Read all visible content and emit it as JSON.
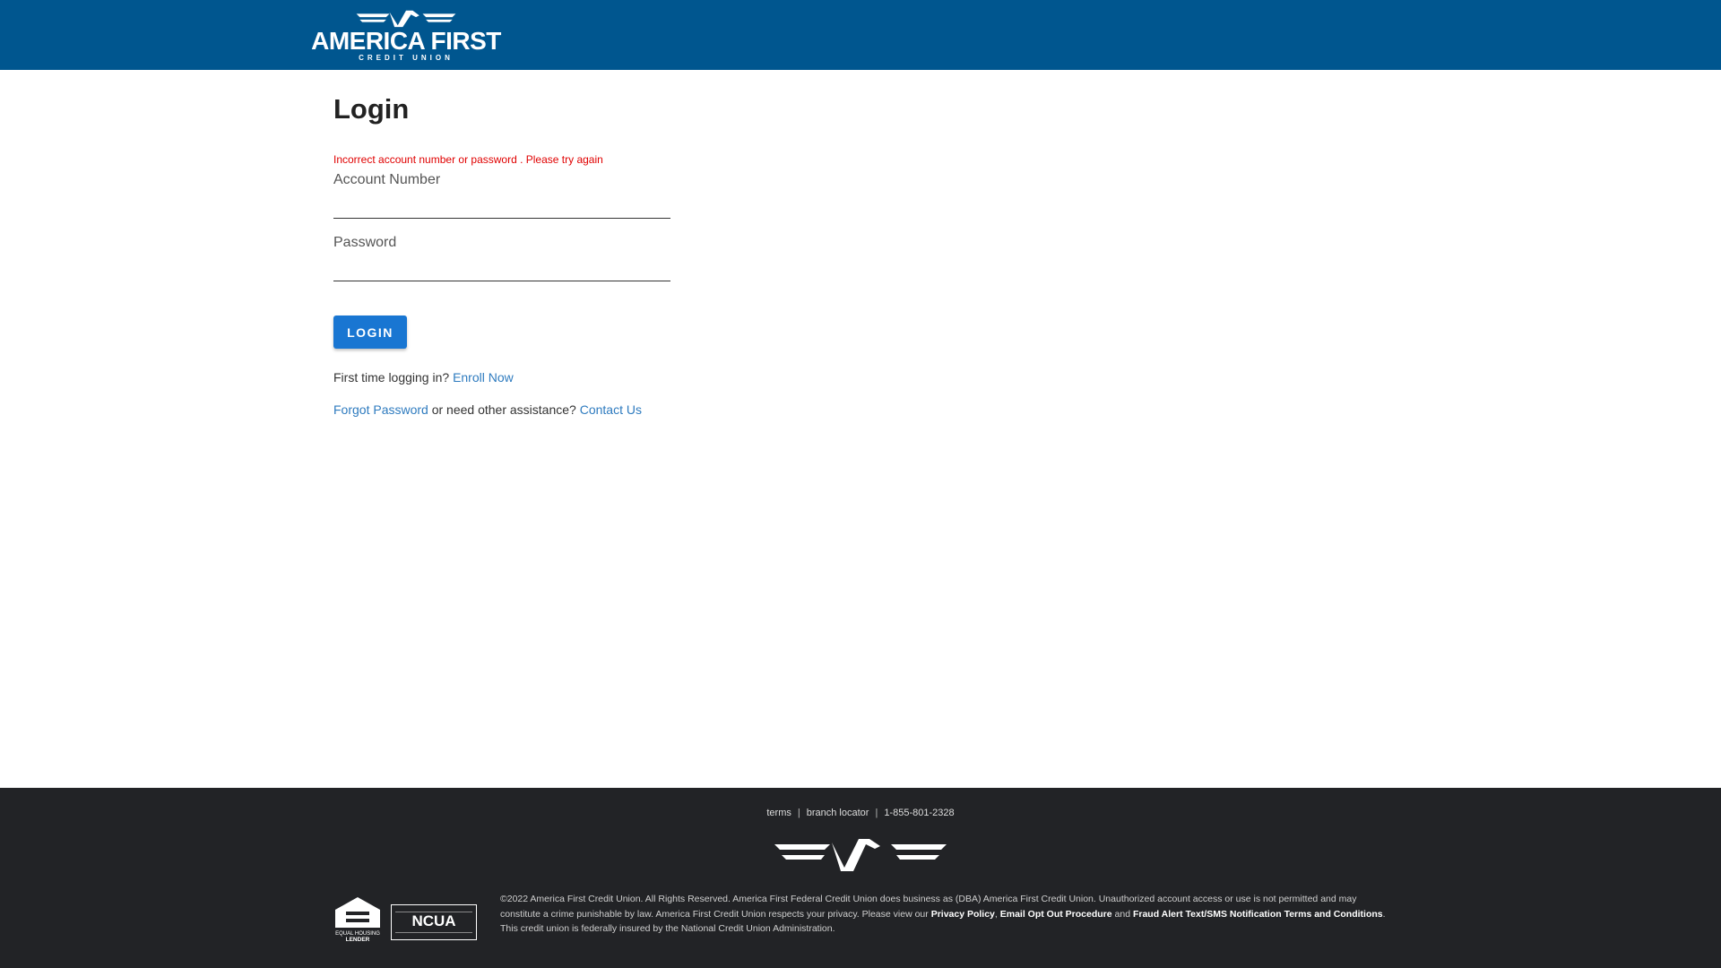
{
  "header": {
    "logo_name": "AMERICA FIRST",
    "logo_sub": "CREDIT UNION",
    "brand_color": "#00568f"
  },
  "login": {
    "title": "Login",
    "error": "Incorrect account number or password . Please try again",
    "account_label": "Account Number",
    "account_value": "",
    "password_label": "Password",
    "password_value": "",
    "button": "LOGIN",
    "first_time_text": "First time logging in?",
    "enroll_link": "Enroll Now",
    "forgot_link": "Forgot Password",
    "assistance_text": "or need other assistance?",
    "contact_link": "Contact Us",
    "button_color": "#1976d2",
    "error_color": "#e00000"
  },
  "footer": {
    "links": [
      "terms",
      "branch locator",
      "1-855-801-2328"
    ],
    "ehl_text": "EQUAL HOUSING LENDER",
    "ncua_text": "NCUA",
    "legal_part1": "©2022 America First Credit Union. All Rights Reserved. America First Federal Credit Union does business as (DBA) America First Credit Union. Unauthorized account access or use is not permitted and may constitute a crime punishable by law. America First Credit Union respects your privacy. Please view our ",
    "privacy_link": "Privacy Policy",
    "comma": ", ",
    "email_opt_link": "Email Opt Out Procedure",
    "and_text": " and ",
    "fraud_link": "Fraud Alert Text/SMS Notification Terms and Conditions",
    "legal_part2": ". This credit union is federally insured by the National Credit Union Administration.",
    "bg_color": "#222326"
  }
}
